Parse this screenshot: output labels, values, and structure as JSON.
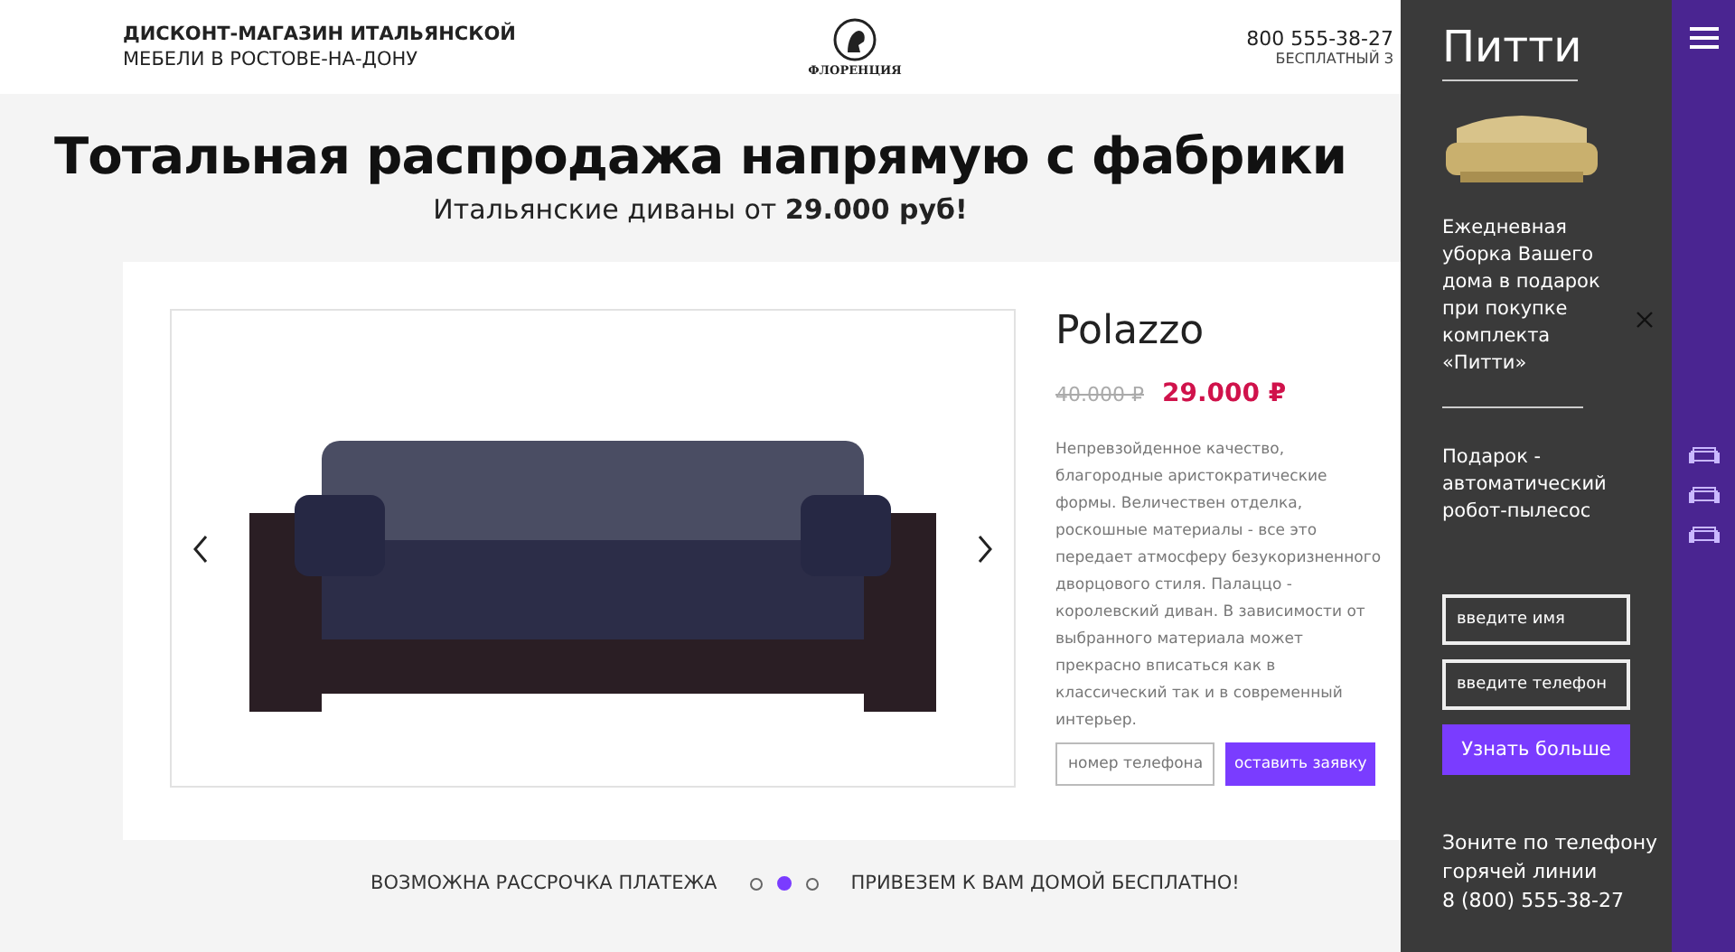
{
  "header": {
    "shop_title": "ДИСКОНТ-МАГАЗИН ИТАЛЬЯНСКОЙ",
    "shop_subtitle": "МЕБЕЛИ В РОСТОВЕ-НА-ДОНУ",
    "logo_text": "ФЛОРЕНЦИЯ",
    "phone": "800 555-38-27",
    "phone_note": "БЕСПЛАТНЫЙ З"
  },
  "hero": {
    "title": "Тотальная распродажа напрямую с фабрики",
    "subtitle": "Итальянские диваны от **29.000 руб!**"
  },
  "product": {
    "name": "Polazzo",
    "old_price": "40.000 ₽",
    "price": "29.000 ₽",
    "description": "Непревзойденное качество, благородные аристократические формы. Величествен отделка, роскошные материалы - все это передает атмосферу безукоризненного дворцового стиля. Палаццо - королевский диван. В зависимости от выбранного материала может прекрасно вписаться как в классический так и в современный интерьер.",
    "phone_placeholder": "номер телефона",
    "submit": "оставить заявку"
  },
  "footer": {
    "left": "ВОЗМОЖНА РАССРОЧКА ПЛАТЕЖА",
    "right": "ПРИВЕЗЕМ К ВАМ ДОМОЙ БЕСПЛАТНО!",
    "dots": [
      {
        "selected": false
      },
      {
        "selected": true
      },
      {
        "selected": false
      }
    ]
  },
  "promo": {
    "title": "Питти",
    "text1": "Ежедневная уборка Вашего дома в подарок при покупке комплекта «Питти»",
    "text2": "Подарок - автоматический робот-пылесос",
    "name_placeholder": "введите имя",
    "phone_placeholder": "введите телефон",
    "button": "Узнать больше",
    "hotline": "Зоните по телефону горячей линии",
    "hotline_phone": "8 (800) 555-38-27"
  }
}
